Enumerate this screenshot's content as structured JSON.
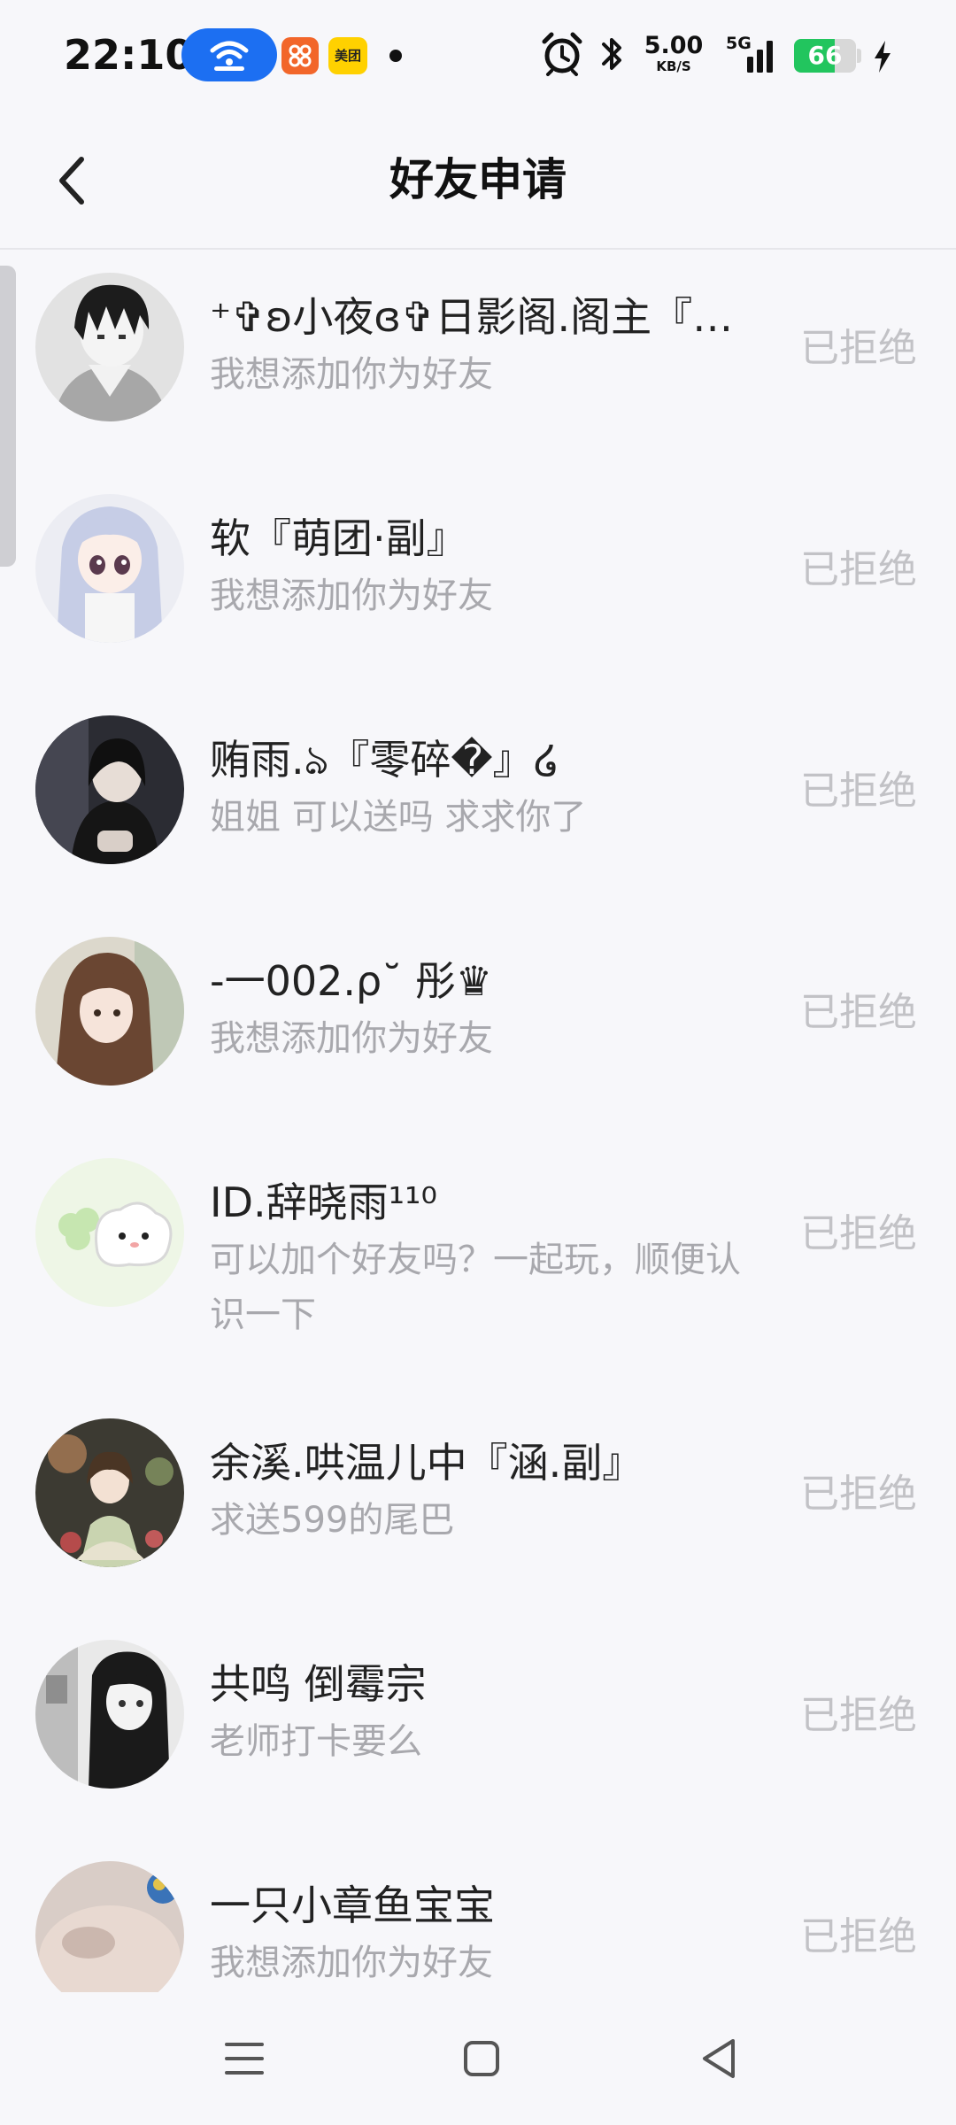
{
  "status_bar": {
    "time": "22:10",
    "app_badge_label": "美团",
    "network_speed": "5.00",
    "network_speed_unit": "KB/S",
    "network_type": "5G",
    "battery_level": "66",
    "battery_fraction": 0.66
  },
  "header": {
    "title": "好友申请"
  },
  "requests": [
    {
      "name": "⁺✞ʚ小夜ɞ✞日影阁.阁主『…",
      "message": "我想添加你为好友",
      "status": "已拒绝"
    },
    {
      "name": "软『萌团·副』",
      "message": "我想添加你为好友",
      "status": "已拒绝"
    },
    {
      "name": "贿雨.ঌ『零碎�』໒",
      "message": "姐姐  可以送吗   求求你了",
      "status": "已拒绝"
    },
    {
      "name": "-一002.ρ˘ 彤♛",
      "message": "我想添加你为好友",
      "status": "已拒绝"
    },
    {
      "name": "ID.辞晓雨¹¹⁰",
      "message": "可以加个好友吗？一起玩，顺便认识一下",
      "status": "已拒绝"
    },
    {
      "name": "余溪.哄温儿中『涵.副』",
      "message": "求送599的尾巴",
      "status": "已拒绝"
    },
    {
      "name": "共鸣  倒霉宗",
      "message": "老师打卡要么",
      "status": "已拒绝"
    },
    {
      "name": "一只小章鱼宝宝",
      "message": "我想添加你为好友",
      "status": "已拒绝"
    }
  ]
}
